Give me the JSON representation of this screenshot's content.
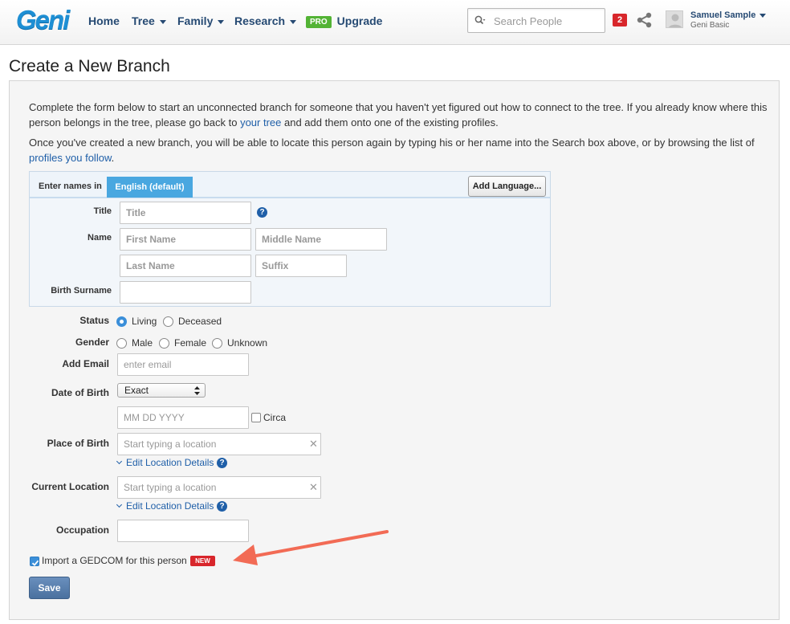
{
  "header": {
    "logo": "Geni",
    "nav": [
      {
        "label": "Home",
        "has_menu": false
      },
      {
        "label": "Tree",
        "has_menu": true
      },
      {
        "label": "Family",
        "has_menu": true
      },
      {
        "label": "Research",
        "has_menu": true
      }
    ],
    "upgrade": {
      "badge": "PRO",
      "label": "Upgrade",
      "badge_color": "#53b335"
    },
    "search": {
      "placeholder": "Search People",
      "value": ""
    },
    "notifications_count": "2",
    "user": {
      "name": "Samuel Sample",
      "plan": "Geni Basic"
    }
  },
  "page_title": "Create a New Branch",
  "intro": {
    "p1_before": "Complete the form below to start an unconnected branch for someone that you haven't yet figured out how to connect to the tree. If you already know where this person belongs in the tree, please go back to ",
    "p1_link": "your tree",
    "p1_after": " and add them onto one of the existing profiles.",
    "p2_before": "Once you've created a new branch, you will be able to locate this person again by typing his or her name into the Search box above, or by browsing the list of ",
    "p2_link": "profiles you follow",
    "p2_after": "."
  },
  "names": {
    "bar_label": "Enter names in",
    "language_tab": "English (default)",
    "add_language": "Add Language...",
    "title_label": "Title",
    "title_placeholder": "Title",
    "name_label": "Name",
    "first_placeholder": "First Name",
    "middle_placeholder": "Middle Name",
    "last_placeholder": "Last Name",
    "suffix_placeholder": "Suffix",
    "birth_surname_label": "Birth Surname",
    "birth_surname_value": ""
  },
  "form": {
    "status_label": "Status",
    "status_options": [
      "Living",
      "Deceased"
    ],
    "status_selected": "Living",
    "gender_label": "Gender",
    "gender_options": [
      "Male",
      "Female",
      "Unknown"
    ],
    "email_label": "Add Email",
    "email_placeholder": "enter email",
    "dob_label": "Date of Birth",
    "dob_precision": "Exact",
    "dob_placeholder": "MM DD YYYY",
    "circa_label": "Circa",
    "pob_label": "Place of Birth",
    "location_placeholder": "Start typing a location",
    "edit_location_label": "Edit Location Details",
    "current_location_label": "Current Location",
    "occupation_label": "Occupation",
    "occupation_value": "",
    "gedcom_label": "Import a GEDCOM for this person",
    "gedcom_checked": true,
    "new_badge": "NEW",
    "save_label": "Save"
  },
  "colors": {
    "link": "#1f5fa8",
    "accent_blue": "#49a7e0",
    "badge_red": "#d8262b",
    "arrow": "#f26b55"
  }
}
